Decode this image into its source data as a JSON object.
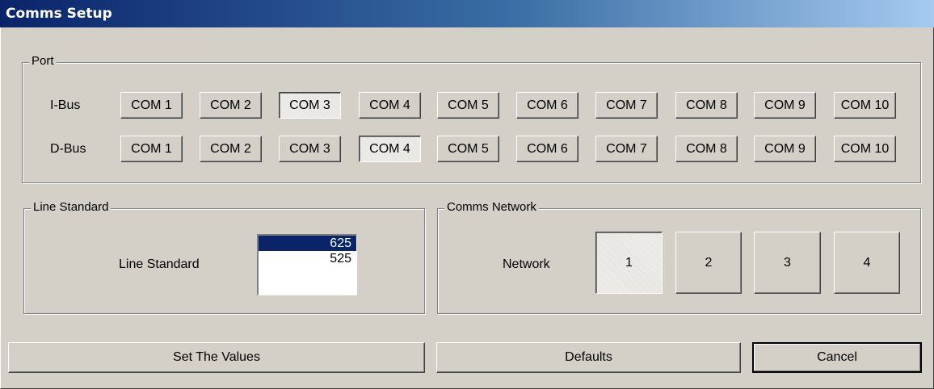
{
  "window": {
    "title": "Comms Setup"
  },
  "port": {
    "legend": "Port",
    "ibus_label": "I-Bus",
    "dbus_label": "D-Bus",
    "ibus_selected": "COM 3",
    "dbus_selected": "COM 4",
    "com_buttons": [
      "COM 1",
      "COM 2",
      "COM 3",
      "COM 4",
      "COM 5",
      "COM 6",
      "COM 7",
      "COM 8",
      "COM 9",
      "COM 10"
    ]
  },
  "line_standard": {
    "legend": "Line Standard",
    "label": "Line Standard",
    "options": [
      "625",
      "525"
    ],
    "selected": "625"
  },
  "comms_network": {
    "legend": "Comms Network",
    "label": "Network",
    "buttons": [
      "1",
      "2",
      "3",
      "4"
    ],
    "selected": "1"
  },
  "actions": {
    "set_values": "Set The Values",
    "defaults": "Defaults",
    "cancel": "Cancel"
  }
}
